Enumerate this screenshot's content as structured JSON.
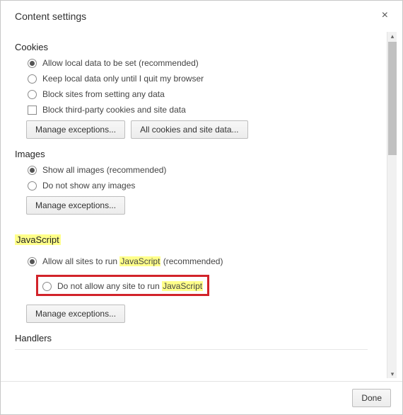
{
  "header": {
    "title": "Content settings",
    "close_glyph": "×"
  },
  "sections": {
    "cookies": {
      "title": "Cookies",
      "options": [
        "Allow local data to be set (recommended)",
        "Keep local data only until I quit my browser",
        "Block sites from setting any data"
      ],
      "checkbox": "Block third-party cookies and site data",
      "buttons": {
        "manage": "Manage exceptions...",
        "all_data": "All cookies and site data..."
      }
    },
    "images": {
      "title": "Images",
      "options": [
        "Show all images (recommended)",
        "Do not show any images"
      ],
      "buttons": {
        "manage": "Manage exceptions..."
      }
    },
    "javascript": {
      "title": "JavaScript",
      "opt1_pre": "Allow all sites to run ",
      "opt1_hl": "JavaScript",
      "opt1_post": " (recommended)",
      "opt2_pre": "Do not allow any site to run ",
      "opt2_hl": "JavaScript",
      "buttons": {
        "manage": "Manage exceptions..."
      }
    },
    "handlers": {
      "title": "Handlers"
    }
  },
  "footer": {
    "done": "Done"
  },
  "scroll": {
    "up": "▴",
    "down": "▾"
  }
}
